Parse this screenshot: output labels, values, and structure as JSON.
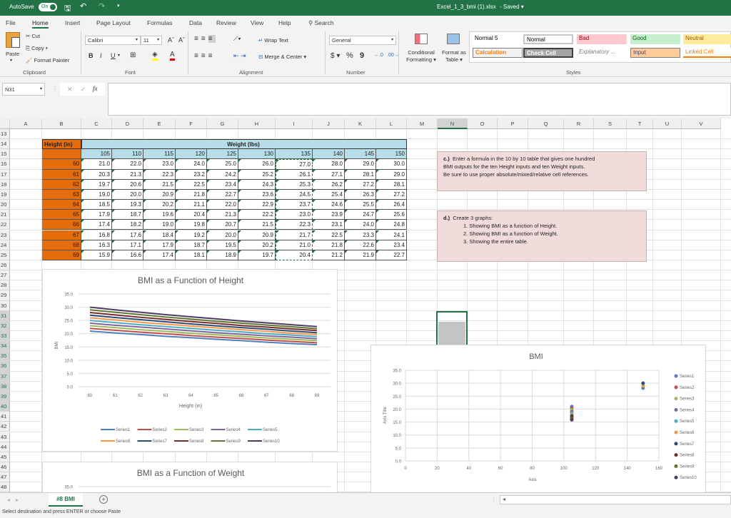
{
  "titlebar": {
    "autosave_label": "AutoSave",
    "autosave_state": "On",
    "filename": "Excel_1_3_bmi (1).xlsx",
    "save_state": "Saved"
  },
  "tabs": [
    "File",
    "Home",
    "Insert",
    "Page Layout",
    "Formulas",
    "Data",
    "Review",
    "View",
    "Help"
  ],
  "active_tab": "Home",
  "search_label": "Search",
  "clipboard": {
    "paste": "Paste",
    "cut": "Cut",
    "copy": "Copy",
    "format_painter": "Format Painter",
    "group": "Clipboard"
  },
  "font": {
    "name": "Calibri",
    "size": "11",
    "bold": "B",
    "italic": "I",
    "underline": "U",
    "group": "Font"
  },
  "alignment": {
    "wrap_text": "Wrap Text",
    "merge_center": "Merge & Center",
    "group": "Alignment"
  },
  "number": {
    "format": "General",
    "currency": "$",
    "percent": "%",
    "comma": "9",
    "group": "Number"
  },
  "styles": {
    "conditional_formatting": [
      "Conditional",
      "Formatting"
    ],
    "format_as_table": [
      "Format as",
      "Table"
    ],
    "gallery": [
      {
        "label": "Normal 5",
        "bg": "#ffffff",
        "fg": "#000000"
      },
      {
        "label": "Normal",
        "bg": "#ffffff",
        "fg": "#000000"
      },
      {
        "label": "Bad",
        "bg": "#ffc7ce",
        "fg": "#9c0006"
      },
      {
        "label": "Good",
        "bg": "#c6efce",
        "fg": "#006100"
      },
      {
        "label": "Neutral",
        "bg": "#ffeb9c",
        "fg": "#9c5700"
      },
      {
        "label": "Calculation",
        "bg": "#f2f2f2",
        "fg": "#fa7d00"
      },
      {
        "label": "Check Cell",
        "bg": "#a5a5a5",
        "fg": "#ffffff"
      },
      {
        "label": "Explanatory ...",
        "bg": "#ffffff",
        "fg": "#7f7f7f"
      },
      {
        "label": "Input",
        "bg": "#ffcc99",
        "fg": "#3f3f76"
      },
      {
        "label": "Linked Cell",
        "bg": "#ffffff",
        "fg": "#fa7d00"
      }
    ],
    "group": "Styles"
  },
  "formula_bar": {
    "name_box": "N31",
    "cancel": "✕",
    "enter": "✓",
    "fx": "fx",
    "formula": ""
  },
  "columns": [
    "A",
    "B",
    "C",
    "D",
    "E",
    "F",
    "G",
    "H",
    "I",
    "J",
    "K",
    "L",
    "M",
    "N",
    "O",
    "P",
    "Q",
    "R",
    "S",
    "T",
    "U",
    "V"
  ],
  "rows": [
    13,
    14,
    15,
    16,
    17,
    18,
    19,
    20,
    21,
    22,
    23,
    24,
    25,
    26,
    27,
    28,
    29,
    30,
    31,
    32,
    33,
    34,
    35,
    36,
    37,
    38,
    39,
    40,
    41,
    42,
    43,
    44,
    45,
    46,
    47,
    48
  ],
  "bmi_table": {
    "height_header": "Height (in)",
    "weight_header": "Weight (lbs)",
    "weights": [
      105,
      110,
      115,
      120,
      125,
      130,
      135,
      140,
      145,
      150
    ],
    "heights": [
      60,
      61,
      62,
      63,
      64,
      65,
      66,
      67,
      68,
      69
    ],
    "values": [
      [
        "21.0",
        "22.0",
        "23.0",
        "24.0",
        "25.0",
        "26.0",
        "27.0",
        "28.0",
        "29.0",
        "30.0"
      ],
      [
        "20.3",
        "21.3",
        "22.3",
        "23.2",
        "24.2",
        "25.2",
        "26.1",
        "27.1",
        "28.1",
        "29.0"
      ],
      [
        "19.7",
        "20.6",
        "21.5",
        "22.5",
        "23.4",
        "24.3",
        "25.3",
        "26.2",
        "27.2",
        "28.1"
      ],
      [
        "19.0",
        "20.0",
        "20.9",
        "21.8",
        "22.7",
        "23.6",
        "24.5",
        "25.4",
        "26.3",
        "27.2"
      ],
      [
        "18.5",
        "19.3",
        "20.2",
        "21.1",
        "22.0",
        "22.9",
        "23.7",
        "24.6",
        "25.5",
        "26.4"
      ],
      [
        "17.9",
        "18.7",
        "19.6",
        "20.4",
        "21.3",
        "22.2",
        "23.0",
        "23.9",
        "24.7",
        "25.6"
      ],
      [
        "17.4",
        "18.2",
        "19.0",
        "19.8",
        "20.7",
        "21.5",
        "22.3",
        "23.1",
        "24.0",
        "24.8"
      ],
      [
        "16.8",
        "17.6",
        "18.4",
        "19.2",
        "20.0",
        "20.9",
        "21.7",
        "22.5",
        "23.3",
        "24.1"
      ],
      [
        "16.3",
        "17.1",
        "17.9",
        "18.7",
        "19.5",
        "20.2",
        "21.0",
        "21.8",
        "22.6",
        "23.4"
      ],
      [
        "15.9",
        "16.6",
        "17.4",
        "18.1",
        "18.9",
        "19.7",
        "20.4",
        "21.2",
        "21.9",
        "22.7"
      ]
    ],
    "colors": {
      "height_bg": "#e46c0a",
      "weight_bg": "#b7dee8"
    }
  },
  "notes": {
    "c": {
      "label": "c.)",
      "lines": [
        "Enter a formula in the 10 by 10 table that gives one hundred",
        "BMI outputs for the ten Height inputs and ten Weight inputs.",
        "Be sure to use proper absolute/mixed/relative cell references."
      ]
    },
    "d": {
      "label": "d.)",
      "title": "Create 3 graphs:",
      "items": [
        "1.  Showing BMI as a function of Height.",
        "2.  Showing BMI as a function of Weight.",
        "3.  Showing the entire table."
      ]
    }
  },
  "series_colors": [
    "#4f81bd",
    "#c0504d",
    "#9bbb59",
    "#8064a2",
    "#4bacc6",
    "#f79646",
    "#2c4d75",
    "#772c2a",
    "#5f7530",
    "#4d3b62"
  ],
  "chart_data": [
    {
      "type": "line",
      "title": "BMI as a Function of Height",
      "xlabel": "Height (in)",
      "ylabel": "BMI",
      "categories": [
        60,
        61,
        62,
        63,
        64,
        65,
        66,
        67,
        68,
        69
      ],
      "ylim": [
        0,
        35
      ],
      "yticks": [
        "0.0",
        "5.0",
        "10.0",
        "15.0",
        "20.0",
        "25.0",
        "30.0",
        "35.0"
      ],
      "grid": true,
      "legend": "bottom",
      "series": [
        {
          "name": "Series1",
          "values": [
            21.0,
            20.3,
            19.7,
            19.0,
            18.5,
            17.9,
            17.4,
            16.8,
            16.3,
            15.9
          ]
        },
        {
          "name": "Series2",
          "values": [
            22.0,
            21.3,
            20.6,
            20.0,
            19.3,
            18.7,
            18.2,
            17.6,
            17.1,
            16.6
          ]
        },
        {
          "name": "Series3",
          "values": [
            23.0,
            22.3,
            21.5,
            20.9,
            20.2,
            19.6,
            19.0,
            18.4,
            17.9,
            17.4
          ]
        },
        {
          "name": "Series4",
          "values": [
            24.0,
            23.2,
            22.5,
            21.8,
            21.1,
            20.4,
            19.8,
            19.2,
            18.7,
            18.1
          ]
        },
        {
          "name": "Series5",
          "values": [
            25.0,
            24.2,
            23.4,
            22.7,
            22.0,
            21.3,
            20.7,
            20.0,
            19.5,
            18.9
          ]
        },
        {
          "name": "Series6",
          "values": [
            26.0,
            25.2,
            24.3,
            23.6,
            22.9,
            22.2,
            21.5,
            20.9,
            20.2,
            19.7
          ]
        },
        {
          "name": "Series7",
          "values": [
            27.0,
            26.1,
            25.3,
            24.5,
            23.7,
            23.0,
            22.3,
            21.7,
            21.0,
            20.4
          ]
        },
        {
          "name": "Series8",
          "values": [
            28.0,
            27.1,
            26.2,
            25.4,
            24.6,
            23.9,
            23.1,
            22.5,
            21.8,
            21.2
          ]
        },
        {
          "name": "Series9",
          "values": [
            29.0,
            28.1,
            27.2,
            26.3,
            25.5,
            24.7,
            24.0,
            23.3,
            22.6,
            21.9
          ]
        },
        {
          "name": "Series10",
          "values": [
            30.0,
            29.0,
            28.1,
            27.2,
            26.4,
            25.6,
            24.8,
            24.1,
            23.4,
            22.7
          ]
        }
      ]
    },
    {
      "type": "line",
      "title": "BMI as a Function of Weight",
      "yticks": [
        "35.0"
      ],
      "ylim": [
        0,
        35
      ]
    },
    {
      "type": "scatter",
      "title": "BMI",
      "xlabel": "Axis",
      "ylabel": "Axis Title",
      "xlim": [
        0,
        160
      ],
      "ylim": [
        0,
        35
      ],
      "xticks": [
        "0",
        "20",
        "40",
        "60",
        "80",
        "100",
        "120",
        "140",
        "160"
      ],
      "yticks": [
        "0.0",
        "5.0",
        "10.0",
        "15.0",
        "20.0",
        "25.0",
        "30.0",
        "35.0"
      ],
      "grid": true,
      "legend": "right",
      "series": [
        {
          "name": "Series1",
          "points": [
            [
              105,
              21.0
            ],
            [
              150,
              28.1
            ]
          ]
        },
        {
          "name": "Series2",
          "points": [
            [
              105,
              20.3
            ]
          ]
        },
        {
          "name": "Series3",
          "points": [
            [
              105,
              19.7
            ]
          ]
        },
        {
          "name": "Series4",
          "points": [
            [
              105,
              19.0
            ]
          ]
        },
        {
          "name": "Series5",
          "points": [
            [
              105,
              18.5
            ]
          ]
        },
        {
          "name": "Series6",
          "points": [
            [
              105,
              17.9
            ],
            [
              150,
              29.0
            ]
          ]
        },
        {
          "name": "Series7",
          "points": [
            [
              105,
              17.4
            ],
            [
              150,
              30.0
            ]
          ]
        },
        {
          "name": "Series8",
          "points": [
            [
              105,
              16.8
            ]
          ]
        },
        {
          "name": "Series9",
          "points": [
            [
              105,
              16.3
            ]
          ]
        },
        {
          "name": "Series10",
          "points": [
            [
              105,
              15.9
            ]
          ]
        }
      ]
    }
  ],
  "sheet_tabs": [
    {
      "label": "#8 BMI",
      "active": true
    }
  ],
  "add_sheet": "+",
  "status_text": "Select destination and press ENTER or choose Paste"
}
